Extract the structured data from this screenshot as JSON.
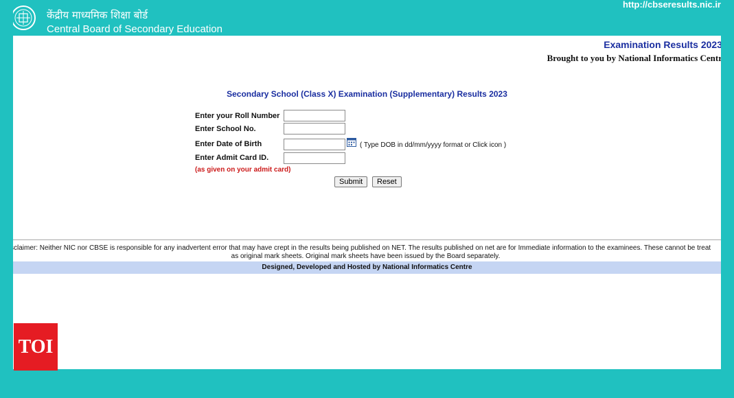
{
  "header": {
    "org_name_hindi": "केंद्रीय माध्यमिक शिक्षा बोर्ड",
    "org_name_english": "Central Board of Secondary Education",
    "site_url": "http://cbseresults.nic.ir"
  },
  "banner": {
    "exam_results": "Examination Results 2023",
    "brought_by": "Brought to you by National Informatics Centr"
  },
  "form": {
    "title": "Secondary School (Class X) Examination (Supplementary) Results 2023",
    "roll_label": "Enter your Roll Number",
    "roll_value": "",
    "school_label": "Enter School No.",
    "school_value": "",
    "dob_label": "Enter Date of Birth",
    "dob_value": "",
    "dob_hint": "( Type DOB in dd/mm/yyyy format or Click icon )",
    "admit_label": "Enter Admit Card ID.",
    "admit_value": "",
    "admit_note": "(as given on your admit card)",
    "submit_label": "Submit",
    "reset_label": "Reset"
  },
  "disclaimer": {
    "line1": "sclaimer: Neither NIC nor CBSE is responsible for any inadvertent error that may have crept in the results being published on NET. The results published on net are for Immediate information to the examinees. These cannot be treat",
    "line2": "as original mark sheets. Original mark sheets have been issued by the Board separately."
  },
  "footer": {
    "hosted_by": "Designed, Developed and Hosted by National Informatics Centre"
  },
  "watermark": {
    "text": "TOI"
  },
  "colors": {
    "accent": "#20c1c0",
    "title_blue": "#1a2ea0",
    "note_red": "#cc1a1a",
    "footer_bar": "#c5d5f3",
    "toi_red": "#e51c23"
  },
  "icons": {
    "logo": "cbse-emblem-icon",
    "calendar": "calendar-icon"
  }
}
